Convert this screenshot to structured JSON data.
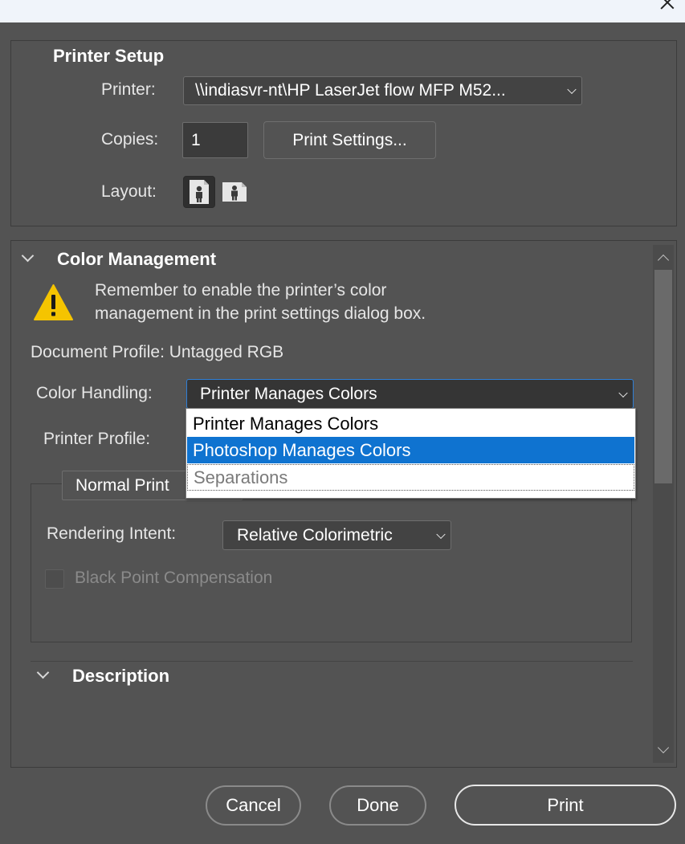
{
  "printer_setup": {
    "title": "Printer Setup",
    "printer_label": "Printer:",
    "printer_value": "\\\\indiasvr-nt\\HP LaserJet flow MFP M52...",
    "copies_label": "Copies:",
    "copies_value": "1",
    "print_settings_label": "Print Settings...",
    "layout_label": "Layout:",
    "layout_options": [
      "portrait-layout-icon",
      "landscape-layout-icon"
    ],
    "layout_selected": "portrait-layout-icon"
  },
  "color_management": {
    "title": "Color Management",
    "warning_line1": "Remember to enable the printer’s color",
    "warning_line2": "management in the print settings dialog box.",
    "document_profile": "Document Profile: Untagged RGB",
    "color_handling_label": "Color Handling:",
    "color_handling_value": "Printer Manages Colors",
    "color_handling_options": [
      "Printer Manages Colors",
      "Photoshop Manages Colors",
      "Separations"
    ],
    "highlighted_option": "Photoshop Manages Colors",
    "disabled_option": "Separations",
    "printer_profile_label": "Printer Profile:",
    "proof_setup_value": "Normal Print",
    "rendering_intent_label": "Rendering Intent:",
    "rendering_intent_value": "Relative Colorimetric",
    "black_point_label": "Black Point Compensation",
    "black_point_checked": false
  },
  "description": {
    "title": "Description"
  },
  "footer": {
    "cancel_label": "Cancel",
    "done_label": "Done",
    "print_label": "Print"
  },
  "colors": {
    "background": "#535353",
    "highlight": "#0f73d0",
    "warning": "#f5c400"
  }
}
